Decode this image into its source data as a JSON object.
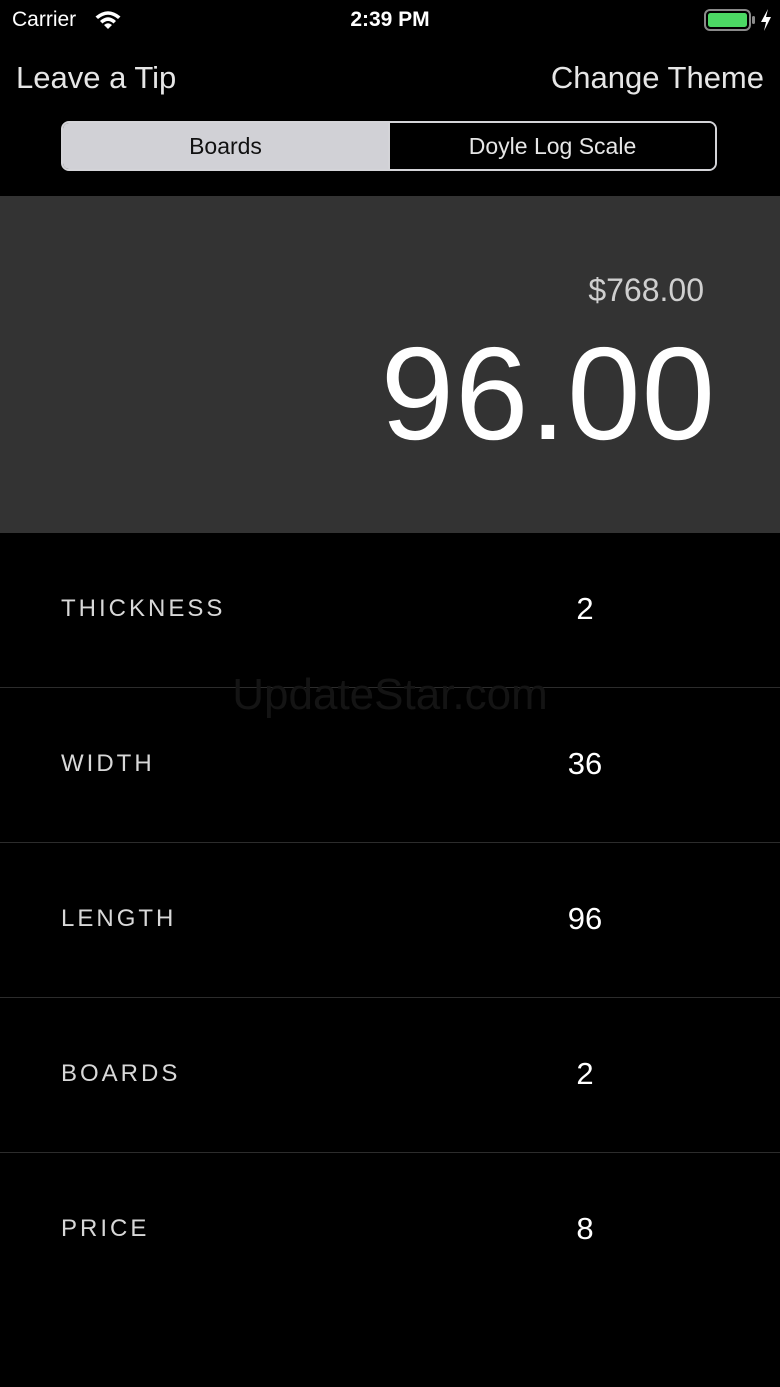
{
  "status_bar": {
    "carrier": "Carrier",
    "time": "2:39 PM",
    "battery_color": "#4cd964"
  },
  "nav": {
    "left_label": "Leave a Tip",
    "right_label": "Change Theme"
  },
  "segmented_control": {
    "options": [
      "Boards",
      "Doyle Log Scale"
    ],
    "selected": "Boards"
  },
  "result": {
    "price_total": "$768.00",
    "board_feet": "96.00"
  },
  "inputs": [
    {
      "label": "THICKNESS",
      "value": "2"
    },
    {
      "label": "WIDTH",
      "value": "36"
    },
    {
      "label": "LENGTH",
      "value": "96"
    },
    {
      "label": "BOARDS",
      "value": "2"
    },
    {
      "label": "PRICE",
      "value": "8"
    }
  ],
  "watermark": "UpdateStar.com",
  "colors": {
    "background": "#000000",
    "panel": "#333333",
    "segment_active": "#d1d1d6"
  }
}
